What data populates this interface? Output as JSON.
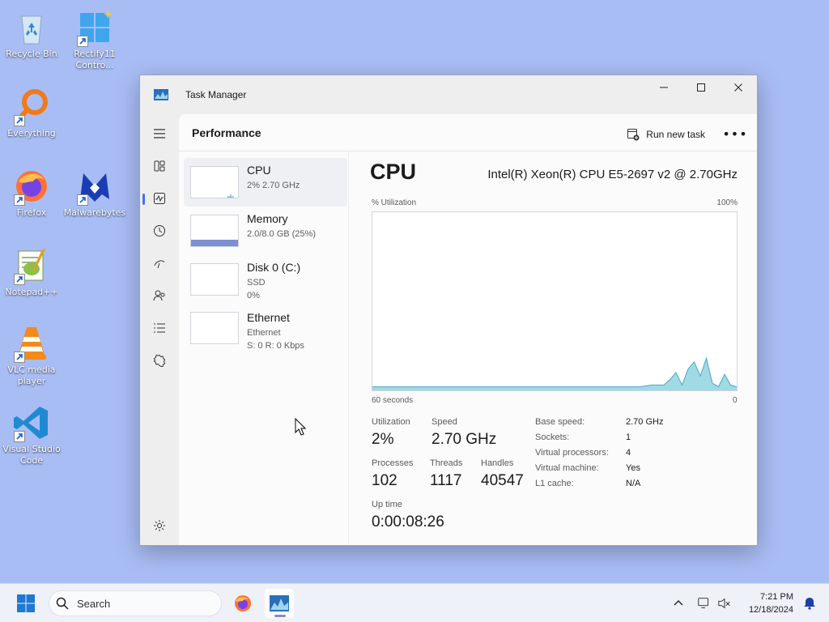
{
  "desktop": {
    "icons": [
      {
        "label": "Recycle Bin",
        "icon": "recycle-bin-icon"
      },
      {
        "label": "Rectify11 Contro...",
        "icon": "control-panel-icon"
      },
      {
        "label": "Everything",
        "icon": "everything-search-icon"
      },
      {
        "label": "Firefox",
        "icon": "firefox-icon"
      },
      {
        "label": "Malwarebytes",
        "icon": "malwarebytes-icon"
      },
      {
        "label": "Notepad++",
        "icon": "notepad-plus-plus-icon"
      },
      {
        "label": "VLC media player",
        "icon": "vlc-icon"
      },
      {
        "label": "Visual Studio Code",
        "icon": "vscode-icon"
      }
    ]
  },
  "window": {
    "title": "Task Manager",
    "page_title": "Performance",
    "run_task": "Run new task",
    "more": "•••"
  },
  "perf_items": [
    {
      "name": "CPU",
      "sub1": "2% 2.70 GHz",
      "sub2": ""
    },
    {
      "name": "Memory",
      "sub1": "2.0/8.0 GB (25%)",
      "sub2": ""
    },
    {
      "name": "Disk 0 (C:)",
      "sub1": "SSD",
      "sub2": "0%"
    },
    {
      "name": "Ethernet",
      "sub1": "Ethernet",
      "sub2": "S: 0 R: 0 Kbps"
    }
  ],
  "detail": {
    "title": "CPU",
    "model": "Intel(R) Xeon(R) CPU E5-2697 v2 @ 2.70GHz",
    "y_label": "% Utilization",
    "y_max": "100%",
    "x_left": "60 seconds",
    "x_right": "0",
    "stats": {
      "utilization_label": "Utilization",
      "utilization": "2%",
      "speed_label": "Speed",
      "speed": "2.70 GHz",
      "processes_label": "Processes",
      "processes": "102",
      "threads_label": "Threads",
      "threads": "1117",
      "handles_label": "Handles",
      "handles": "40547",
      "uptime_label": "Up time",
      "uptime": "0:00:08:26"
    },
    "specs": [
      {
        "k": "Base speed:",
        "v": "2.70 GHz"
      },
      {
        "k": "Sockets:",
        "v": "1"
      },
      {
        "k": "Virtual processors:",
        "v": "4"
      },
      {
        "k": "Virtual machine:",
        "v": "Yes"
      },
      {
        "k": "L1 cache:",
        "v": "N/A"
      }
    ]
  },
  "chart_data": {
    "type": "area",
    "xlim": [
      60,
      0
    ],
    "ylim": [
      0,
      100
    ],
    "x": [
      60,
      58,
      56,
      54,
      52,
      50,
      48,
      46,
      44,
      42,
      40,
      38,
      36,
      34,
      32,
      30,
      28,
      26,
      24,
      22,
      20,
      18,
      16,
      14,
      12,
      11,
      10,
      9,
      8,
      7,
      6,
      5,
      4,
      3,
      2,
      1,
      0
    ],
    "values": [
      2,
      2,
      2,
      2,
      2,
      2,
      2,
      2,
      2,
      2,
      2,
      2,
      2,
      2,
      2,
      2,
      2,
      2,
      2,
      2,
      2,
      2,
      2,
      3,
      3,
      6,
      10,
      3,
      12,
      16,
      8,
      18,
      4,
      2,
      9,
      3,
      2
    ]
  },
  "taskbar": {
    "search_placeholder": "Search",
    "time": "7:21 PM",
    "date": "12/18/2024"
  },
  "colors": {
    "graph_line": "#4aa8c4",
    "graph_fill": "#8ed3e0",
    "memory_fill": "#7d8fd0",
    "accent": "#4a6ef5"
  }
}
